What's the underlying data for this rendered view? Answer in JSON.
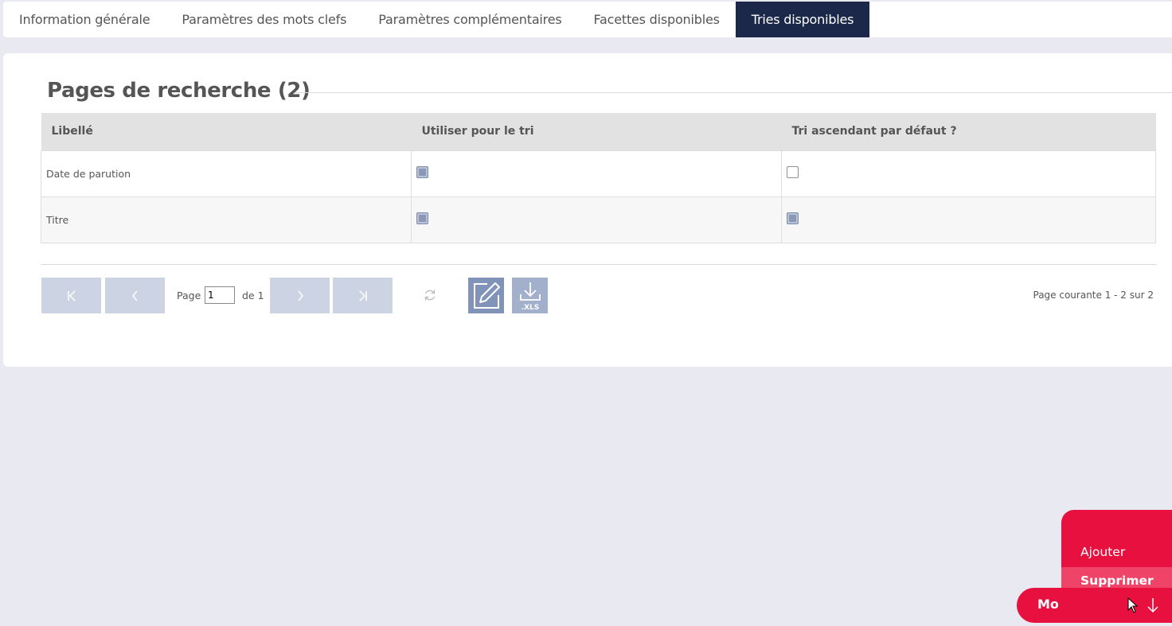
{
  "tabs": [
    {
      "label": "Information générale",
      "active": false
    },
    {
      "label": "Paramètres des mots clefs",
      "active": false
    },
    {
      "label": "Paramètres complémentaires",
      "active": false
    },
    {
      "label": "Facettes disponibles",
      "active": false
    },
    {
      "label": "Tries disponibles",
      "active": true
    }
  ],
  "section": {
    "title": "Pages de recherche (2)"
  },
  "table": {
    "columns": [
      "Libellé",
      "Utiliser pour le tri",
      "Tri ascendant par défaut ?"
    ],
    "rows": [
      {
        "label": "Date de parution",
        "use_for_sort": true,
        "ascending_default": false
      },
      {
        "label": "Titre",
        "use_for_sort": true,
        "ascending_default": true
      }
    ]
  },
  "pagination": {
    "page_label": "Page",
    "current_page": "1",
    "of_label": "de 1",
    "info": "Page courante 1 - 2 sur 2"
  },
  "export": {
    "xls_label": ".XLS"
  },
  "fab": {
    "items": [
      "Ajouter",
      "Supprimer"
    ],
    "main_label": "Mod",
    "color": "#e8103e"
  },
  "colors": {
    "active_tab": "#1b2849",
    "pager_button": "#ccd4e3",
    "accent": "#e8103e"
  }
}
